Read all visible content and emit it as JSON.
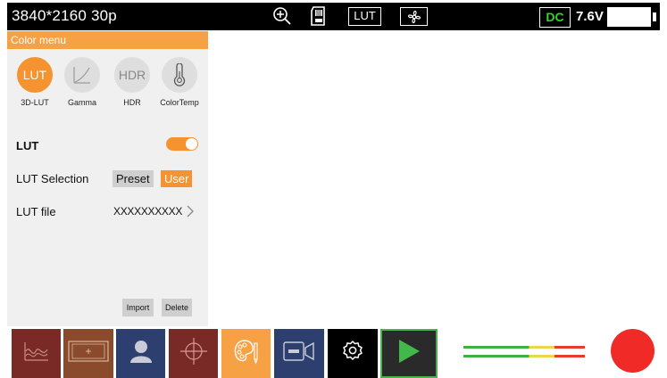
{
  "status_bar": {
    "resolution": "3840*2160 30p",
    "lut_badge": "LUT",
    "power_source": "DC",
    "voltage": "7.6V"
  },
  "color_menu": {
    "title": "Color menu",
    "categories": [
      {
        "icon_text": "LUT",
        "label": "3D-LUT",
        "active": true
      },
      {
        "icon_text": "",
        "label": "Gamma",
        "icon": "gamma-curve-icon",
        "active": false
      },
      {
        "icon_text": "HDR",
        "label": "HDR",
        "active": false
      },
      {
        "icon_text": "",
        "label": "ColorTemp",
        "icon": "thermometer-icon",
        "active": false
      }
    ],
    "lut_label": "LUT",
    "lut_enabled": true,
    "lut_selection_label": "LUT Selection",
    "preset_option": "Preset",
    "user_option": "User",
    "selected_option": "User",
    "lut_file_label": "LUT file",
    "lut_file_value": "XXXXXXXXXX",
    "import_button": "Import",
    "delete_button": "Delete"
  },
  "toolbar": {
    "tools": [
      {
        "icon": "waveform-icon",
        "color": "#7a2a26"
      },
      {
        "icon": "frame-guide-icon",
        "color": "#8a4a2c"
      },
      {
        "icon": "user-profile-icon",
        "color": "#2c3f6e"
      },
      {
        "icon": "crosshair-icon",
        "color": "#7a2a26"
      },
      {
        "icon": "color-palette-icon",
        "color": "#f6a244"
      },
      {
        "icon": "camera-icon",
        "color": "#2c3f6e"
      },
      {
        "icon": "settings-gear-icon",
        "color": "#000000"
      },
      {
        "icon": "play-icon",
        "color": "#2a2a2a"
      }
    ],
    "audio_meter": {
      "channels": 2,
      "colors": [
        "#3cb043",
        "#e8d84a",
        "#e83a2e"
      ]
    },
    "record_color": "#f02a26"
  },
  "colors": {
    "accent": "#f69331",
    "header": "#f6a244",
    "status_ok": "#35d135"
  }
}
